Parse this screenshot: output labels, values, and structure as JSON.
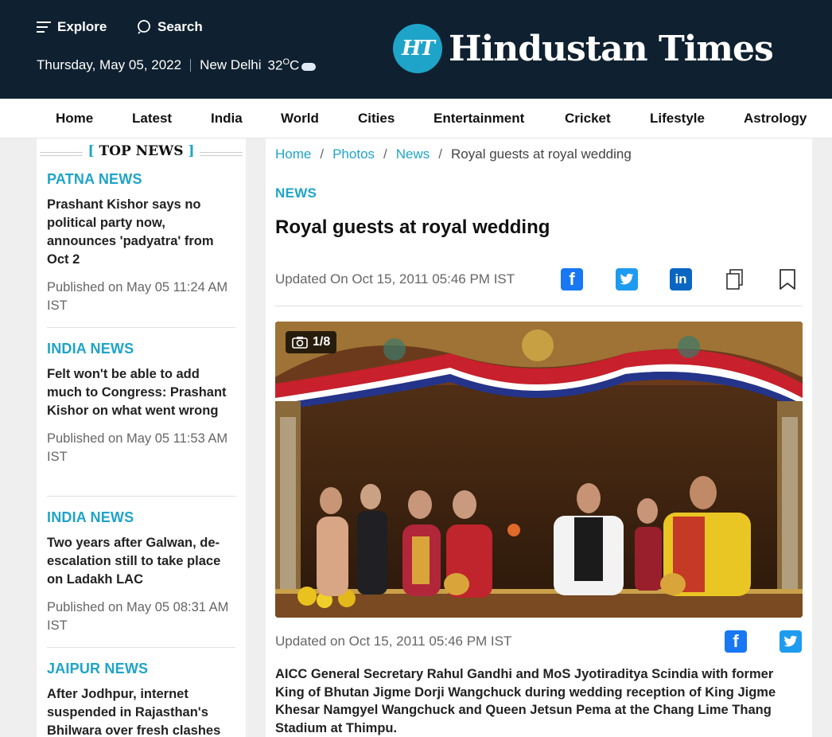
{
  "header": {
    "explore_label": "Explore",
    "search_label": "Search",
    "date": "Thursday, May 05, 2022",
    "city": "New Delhi",
    "temp_value": "32",
    "temp_unit": "C",
    "logo_mark": "HT",
    "brand": "Hindustan Times"
  },
  "nav": {
    "items": [
      "Home",
      "Latest",
      "India",
      "World",
      "Cities",
      "Entertainment",
      "Cricket",
      "Lifestyle",
      "Astrology"
    ]
  },
  "sidebar": {
    "heading": "TOP NEWS",
    "items": [
      {
        "category": "PATNA NEWS",
        "title": "Prashant Kishor says no political party now, announces 'padyatra' from Oct 2",
        "published": "Published on May 05 11:24 AM IST"
      },
      {
        "category": "INDIA NEWS",
        "title": "Felt won't be able to add much to Congress: Prashant Kishor on what went wrong",
        "published": "Published on May 05 11:53 AM IST"
      },
      {
        "category": "INDIA NEWS",
        "title": "Two years after Galwan, de-escalation still to take place on Ladakh LAC",
        "published": "Published on May 05 08:31 AM IST"
      },
      {
        "category": "JAIPUR NEWS",
        "title": "After Jodhpur, internet suspended in Rajasthan's Bhilwara over fresh clashes",
        "published": ""
      }
    ]
  },
  "article": {
    "breadcrumb": [
      "Home",
      "Photos",
      "News",
      "Royal guests at royal wedding"
    ],
    "section": "NEWS",
    "headline": "Royal guests at royal wedding",
    "updated_top": "Updated On Oct 15, 2011 05:46 PM IST",
    "photo_counter": "1/8",
    "updated_photo": "Updated on Oct 15, 2011 05:46 PM IST",
    "caption": "AICC General Secretary Rahul Gandhi and MoS Jyotiraditya Scindia with former King of Bhutan Jigme Dorji Wangchuck during wedding reception of King Jigme Khesar Namgyel Wangchuck and Queen Jetsun Pema at the Chang Lime Thang Stadium at Thimpu."
  },
  "icons": {
    "menu": "hamburger-menu-icon",
    "search": "search-icon",
    "weather": "cloud-icon",
    "share": [
      "facebook-icon",
      "twitter-icon",
      "linkedin-icon",
      "copy-icon",
      "bookmark-icon"
    ],
    "camera": "camera-icon"
  },
  "colors": {
    "header_bg": "#0f2130",
    "accent": "#1fa4c9",
    "facebook": "#1877f2",
    "twitter": "#1d9bf0",
    "linkedin": "#0a66c2"
  }
}
